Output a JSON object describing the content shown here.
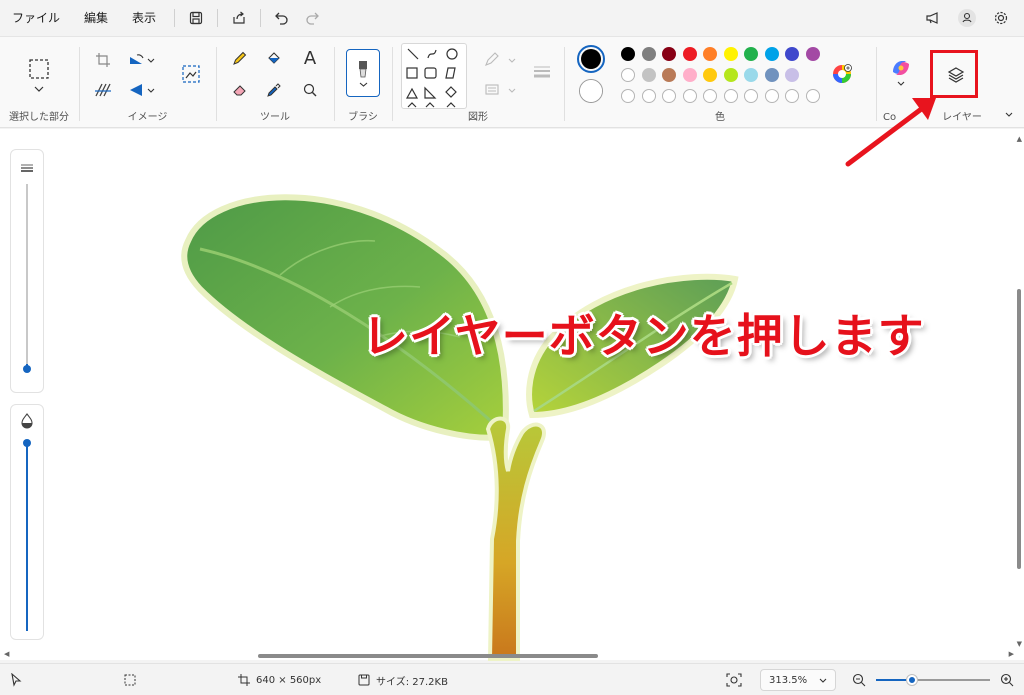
{
  "menu": {
    "file": "ファイル",
    "edit": "編集",
    "view": "表示"
  },
  "ribbon": {
    "selection_label": "選択した部分",
    "image_label": "イメージ",
    "tools_label": "ツール",
    "tools_text_glyph": "A",
    "brush_label": "ブラシ",
    "shapes_label": "図形",
    "color_label": "色",
    "copilot_label": "Co",
    "layers_label": "レイヤー"
  },
  "palette": {
    "row1": [
      "#000000",
      "#7f7f7f",
      "#880015",
      "#ed1c24",
      "#ff7f27",
      "#fff200",
      "#22b14c",
      "#00a2e8",
      "#3f48cc",
      "#a349a4"
    ],
    "row2": [
      "#ffffff",
      "#c3c3c3",
      "#b97a57",
      "#ffaec9",
      "#ffc90e",
      "#b5e61d",
      "#99d9ea",
      "#7092be",
      "#c8bfe7"
    ],
    "primary": "#000000",
    "secondary": "#ffffff"
  },
  "annotation": {
    "text": "レイヤーボタンを押します",
    "color": "#e6111b"
  },
  "status": {
    "canvas_size": "640 × 560px",
    "file_size": "サイズ: 27.2KB",
    "zoom": "313.5%"
  }
}
